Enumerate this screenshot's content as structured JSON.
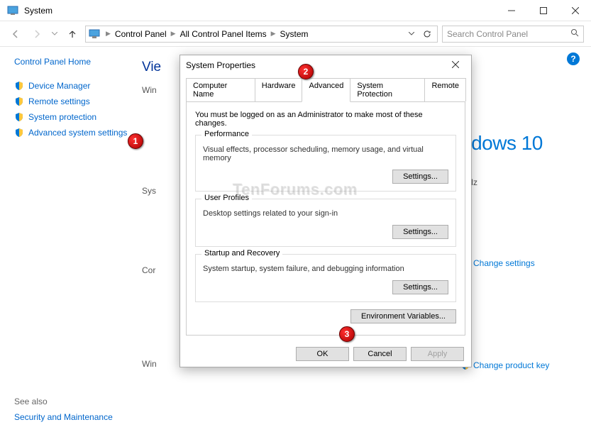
{
  "window": {
    "title": "System"
  },
  "nav": {
    "crumbs": [
      "Control Panel",
      "All Control Panel Items",
      "System"
    ],
    "search_placeholder": "Search Control Panel"
  },
  "sidebar": {
    "home": "Control Panel Home",
    "links": [
      {
        "label": "Device Manager"
      },
      {
        "label": "Remote settings"
      },
      {
        "label": "System protection"
      },
      {
        "label": "Advanced system settings"
      }
    ],
    "seealso_hdr": "See also",
    "seealso_link": "Security and Maintenance"
  },
  "content": {
    "heading_cut": "Vie",
    "labels": {
      "win": "Win",
      "sys": "Sys",
      "cor": "Cor",
      "win2": "Win"
    },
    "right": {
      "win10": "ndows 10",
      "ghz": "GHz",
      "change_settings": "Change settings",
      "change_product": "Change product key"
    }
  },
  "dialog": {
    "title": "System Properties",
    "tabs": [
      "Computer Name",
      "Hardware",
      "Advanced",
      "System Protection",
      "Remote"
    ],
    "active_tab": 2,
    "intro": "You must be logged on as an Administrator to make most of these changes.",
    "groups": [
      {
        "title": "Performance",
        "desc": "Visual effects, processor scheduling, memory usage, and virtual memory",
        "btn": "Settings..."
      },
      {
        "title": "User Profiles",
        "desc": "Desktop settings related to your sign-in",
        "btn": "Settings..."
      },
      {
        "title": "Startup and Recovery",
        "desc": "System startup, system failure, and debugging information",
        "btn": "Settings..."
      }
    ],
    "env_btn": "Environment Variables...",
    "ok": "OK",
    "cancel": "Cancel",
    "apply": "Apply"
  },
  "markers": {
    "m1": "1",
    "m2": "2",
    "m3": "3"
  },
  "watermark": "TenForums.com"
}
